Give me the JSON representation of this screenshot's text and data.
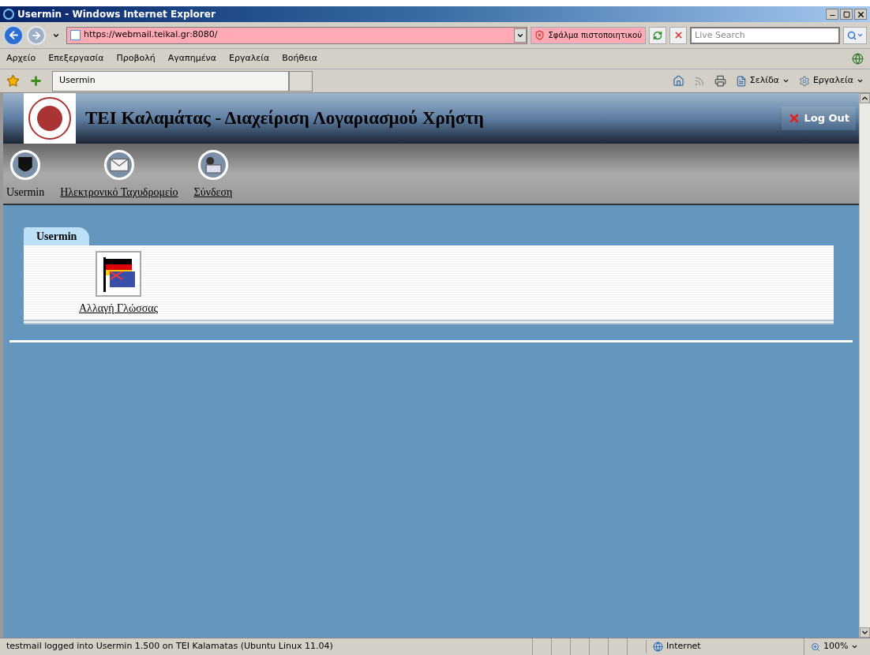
{
  "window": {
    "title": "Usermin - Windows Internet Explorer"
  },
  "address": {
    "url": "https://webmail.teikal.gr:8080/",
    "security_badge": "Σφάλμα πιστοποιητικού"
  },
  "search": {
    "placeholder": "Live Search"
  },
  "menu": [
    "Αρχείο",
    "Επεξεργασία",
    "Προβολή",
    "Αγαπημένα",
    "Εργαλεία",
    "Βοήθεια"
  ],
  "browser_tabs": [
    {
      "label": "Usermin",
      "selected": true
    }
  ],
  "command_bar": {
    "page": "Σελίδα",
    "tools": "Εργαλεία"
  },
  "page": {
    "header_title": "TEI Καλαμάτας - Διαχείριση Λογαριασμού Χρήστη",
    "logout": "Log Out",
    "nav": [
      {
        "label": "Usermin",
        "kind": "usermin",
        "selected": true
      },
      {
        "label": "Ηλεκτρονικό Ταχυδρομείο",
        "kind": "mail",
        "selected": false
      },
      {
        "label": "Σύνδεση",
        "kind": "login",
        "selected": false
      }
    ],
    "tabs": [
      {
        "label": "Usermin",
        "selected": true
      }
    ],
    "modules": [
      {
        "label": "Αλλαγή Γλώσσας"
      }
    ]
  },
  "status_bar": {
    "text": "testmail logged into Usermin 1.500 on TEI Kalamatas (Ubuntu Linux 11.04)",
    "zone": "Internet",
    "zoom": "100%"
  }
}
